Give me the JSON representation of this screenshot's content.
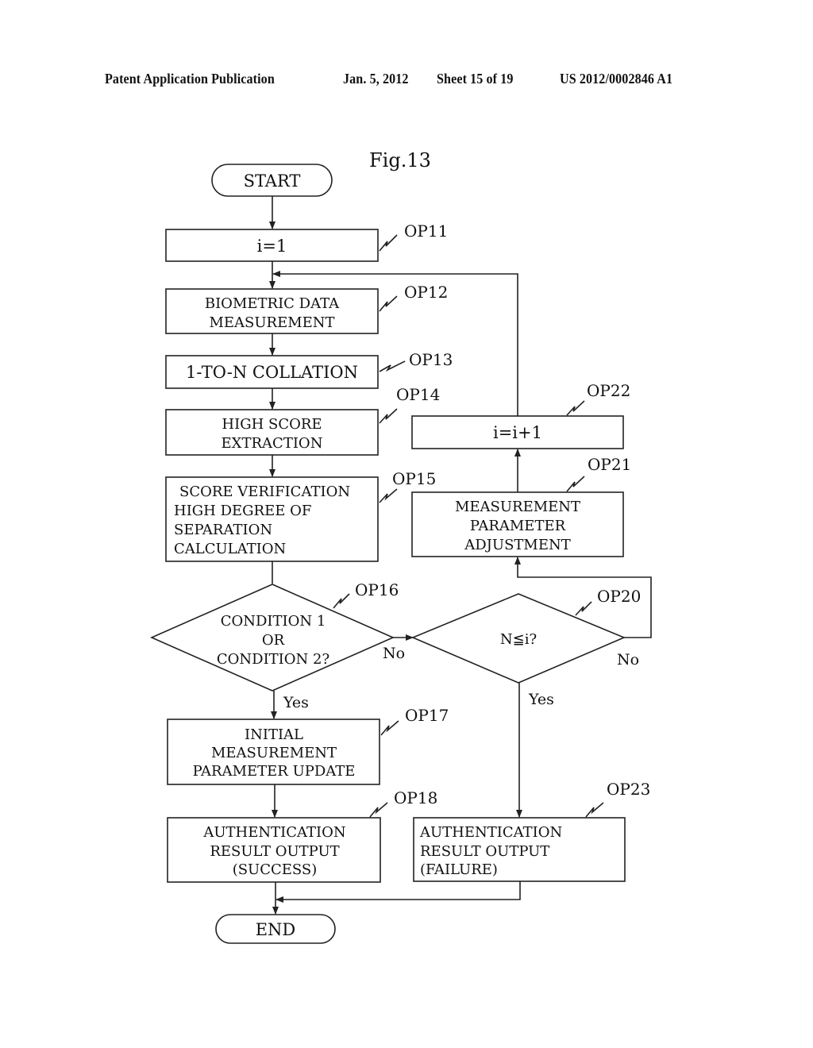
{
  "header": {
    "publication": "Patent Application Publication",
    "date": "Jan. 5, 2012",
    "sheet": "Sheet 15 of 19",
    "number": "US 2012/0002846 A1"
  },
  "figure": {
    "title": "Fig.13",
    "terminals": {
      "start": "START",
      "end": "END"
    },
    "steps": {
      "op11": {
        "ref": "OP11",
        "lines": [
          "i=1"
        ]
      },
      "op12": {
        "ref": "OP12",
        "lines": [
          "BIOMETRIC DATA",
          "MEASUREMENT"
        ]
      },
      "op13": {
        "ref": "OP13",
        "lines": [
          "1-TO-N COLLATION"
        ]
      },
      "op14": {
        "ref": "OP14",
        "lines": [
          "HIGH SCORE",
          "EXTRACTION"
        ]
      },
      "op15": {
        "ref": "OP15",
        "lines": [
          "SCORE VERIFICATION",
          "HIGH DEGREE OF",
          "SEPARATION",
          "CALCULATION"
        ]
      },
      "op16": {
        "ref": "OP16",
        "lines": [
          "CONDITION 1",
          "OR",
          "CONDITION 2?"
        ]
      },
      "op17": {
        "ref": "OP17",
        "lines": [
          "INITIAL",
          "MEASUREMENT",
          "PARAMETER UPDATE"
        ]
      },
      "op18": {
        "ref": "OP18",
        "lines": [
          "AUTHENTICATION",
          "RESULT OUTPUT",
          "(SUCCESS)"
        ]
      },
      "op20": {
        "ref": "OP20",
        "lines": [
          "N≦i?"
        ]
      },
      "op21": {
        "ref": "OP21",
        "lines": [
          "MEASUREMENT",
          "PARAMETER",
          "ADJUSTMENT"
        ]
      },
      "op22": {
        "ref": "OP22",
        "lines": [
          "i=i+1"
        ]
      },
      "op23": {
        "ref": "OP23",
        "lines": [
          "AUTHENTICATION",
          "RESULT OUTPUT",
          "(FAILURE)"
        ]
      }
    },
    "branch_labels": {
      "op16_no": "No",
      "op16_yes": "Yes",
      "op20_no": "No",
      "op20_yes": "Yes"
    }
  }
}
